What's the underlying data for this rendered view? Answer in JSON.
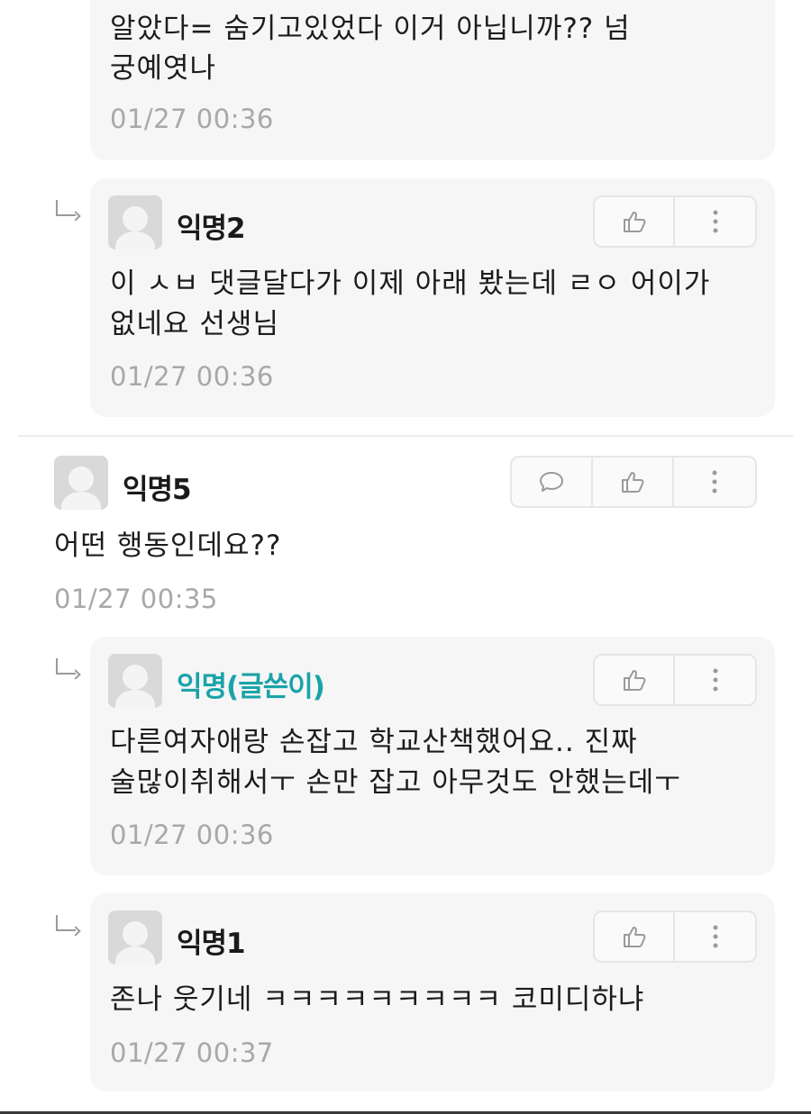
{
  "comments": [
    {
      "kind": "reply-partial",
      "text_lines": [
        "알았다= 숨기고있었다 이거 아닙니까?? 넘",
        "궁예엿나"
      ],
      "time": "01/27 00:36"
    },
    {
      "kind": "reply",
      "nick": "익명2",
      "text_lines": [
        "이 ㅅㅂ 댓글달다가 이제 아래 봤는데 ㄹㅇ 어이가",
        "없네요 선생님"
      ],
      "time": "01/27 00:36"
    },
    {
      "kind": "comment",
      "nick": "익명5",
      "text_lines": [
        "어떤 행동인데요??"
      ],
      "time": "01/27 00:35"
    },
    {
      "kind": "reply",
      "nick": "익명(글쓴이)",
      "text_lines": [
        "다른여자애랑 손잡고 학교산책했어요.. 진짜",
        "술많이취해서ㅜ 손만 잡고 아무것도 안했는데ㅜ"
      ],
      "time": "01/27 00:36"
    },
    {
      "kind": "reply",
      "nick": "익명1",
      "text_lines": [
        "존나 웃기네 ㅋㅋㅋㅋㅋㅋㅋㅋㅋ 코미디하냐"
      ],
      "time": "01/27 00:37"
    }
  ],
  "icons": {
    "comment": "speech-bubble-icon",
    "like": "thumbs-up-icon",
    "more": "more-vertical-icon",
    "reply": "reply-arrow-icon",
    "avatar": "default-avatar-icon"
  },
  "colors": {
    "op_nick": "#1aa3a8",
    "time": "#a8a8a8",
    "reply_bg": "#f6f6f6"
  }
}
